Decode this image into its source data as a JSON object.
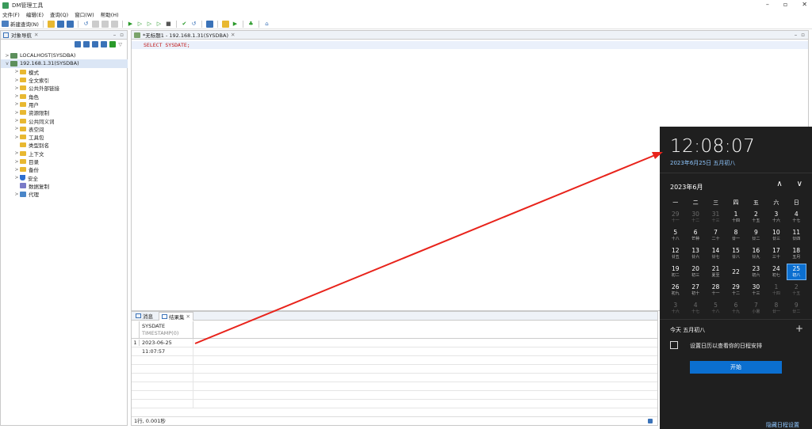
{
  "window": {
    "title": "DM管理工具",
    "min": "–",
    "max": "▫",
    "close": "✕"
  },
  "menu": [
    "文件(F)",
    "编辑(E)",
    "查询(Q)",
    "窗口(W)",
    "帮助(H)"
  ],
  "toolbar": {
    "new_query": "新建查询(N)"
  },
  "nav_panel": {
    "tab_label": "对象导航",
    "tree": [
      {
        "label": "LOCALHOST(SYSDBA)",
        "level": 0,
        "arrow": ">",
        "icon": "db"
      },
      {
        "label": "192.168.1.31(SYSDBA)",
        "level": 0,
        "arrow": "v",
        "icon": "db"
      },
      {
        "label": "模式",
        "level": 1,
        "arrow": ">",
        "icon": "folder"
      },
      {
        "label": "全文索引",
        "level": 1,
        "arrow": ">",
        "icon": "folder"
      },
      {
        "label": "公共外部链接",
        "level": 1,
        "arrow": ">",
        "icon": "folder"
      },
      {
        "label": "角色",
        "level": 1,
        "arrow": ">",
        "icon": "folder"
      },
      {
        "label": "用户",
        "level": 1,
        "arrow": ">",
        "icon": "folder"
      },
      {
        "label": "资源限制",
        "level": 1,
        "arrow": ">",
        "icon": "folder"
      },
      {
        "label": "公共同义词",
        "level": 1,
        "arrow": ">",
        "icon": "folder"
      },
      {
        "label": "表空间",
        "level": 1,
        "arrow": ">",
        "icon": "folder"
      },
      {
        "label": "工具包",
        "level": 1,
        "arrow": ">",
        "icon": "folder"
      },
      {
        "label": "类型别名",
        "level": 1,
        "arrow": "",
        "icon": "folder"
      },
      {
        "label": "上下文",
        "level": 1,
        "arrow": ">",
        "icon": "folder"
      },
      {
        "label": "目录",
        "level": 1,
        "arrow": ">",
        "icon": "folder"
      },
      {
        "label": "备份",
        "level": 1,
        "arrow": ">",
        "icon": "folder"
      },
      {
        "label": "安全",
        "level": 1,
        "arrow": ">",
        "icon": "shield"
      },
      {
        "label": "数据复制",
        "level": 1,
        "arrow": "",
        "icon": "repl"
      },
      {
        "label": "代理",
        "level": 1,
        "arrow": ">",
        "icon": "stack"
      }
    ]
  },
  "editor": {
    "tab_label": "*无标题1 - 192.168.1.31(SYSDBA)",
    "sql": "SELECT SYSDATE;"
  },
  "results": {
    "tabs": [
      "消息",
      "结果集"
    ],
    "column": {
      "name": "SYSDATE",
      "type": "TIMESTAMP(0)"
    },
    "rows": [
      {
        "num": "1",
        "value": "2023-06-25 11:07:57"
      }
    ],
    "status": "1行, 0.001秒"
  },
  "calendar": {
    "time": "12:08:07",
    "date": "2023年6月25日 五月初八",
    "month": "2023年6月",
    "weekdays": [
      "一",
      "二",
      "三",
      "四",
      "五",
      "六",
      "日"
    ],
    "days": [
      {
        "n": "29",
        "l": "十一",
        "dim": true
      },
      {
        "n": "30",
        "l": "十二",
        "dim": true
      },
      {
        "n": "31",
        "l": "十三",
        "dim": true
      },
      {
        "n": "1",
        "l": "十四"
      },
      {
        "n": "2",
        "l": "十五"
      },
      {
        "n": "3",
        "l": "十六"
      },
      {
        "n": "4",
        "l": "十七"
      },
      {
        "n": "5",
        "l": "十八"
      },
      {
        "n": "6",
        "l": "芒种"
      },
      {
        "n": "7",
        "l": "二十"
      },
      {
        "n": "8",
        "l": "廿一"
      },
      {
        "n": "9",
        "l": "廿二"
      },
      {
        "n": "10",
        "l": "廿三"
      },
      {
        "n": "11",
        "l": "廿四"
      },
      {
        "n": "12",
        "l": "廿五"
      },
      {
        "n": "13",
        "l": "廿六"
      },
      {
        "n": "14",
        "l": "廿七"
      },
      {
        "n": "15",
        "l": "廿八"
      },
      {
        "n": "16",
        "l": "廿九"
      },
      {
        "n": "17",
        "l": "三十"
      },
      {
        "n": "18",
        "l": "五月"
      },
      {
        "n": "19",
        "l": "初二"
      },
      {
        "n": "20",
        "l": "初三"
      },
      {
        "n": "21",
        "l": "夏至"
      },
      {
        "n": "22",
        "l": ""
      },
      {
        "n": "23",
        "l": "初六"
      },
      {
        "n": "24",
        "l": "初七"
      },
      {
        "n": "25",
        "l": "初八",
        "today": true
      },
      {
        "n": "26",
        "l": "初九"
      },
      {
        "n": "27",
        "l": "初十"
      },
      {
        "n": "28",
        "l": "十一"
      },
      {
        "n": "29",
        "l": "十二"
      },
      {
        "n": "30",
        "l": "十三"
      },
      {
        "n": "1",
        "l": "十四",
        "dim": true
      },
      {
        "n": "2",
        "l": "十五",
        "dim": true
      },
      {
        "n": "3",
        "l": "十六",
        "dim": true
      },
      {
        "n": "4",
        "l": "十七",
        "dim": true
      },
      {
        "n": "5",
        "l": "十八",
        "dim": true
      },
      {
        "n": "6",
        "l": "十九",
        "dim": true
      },
      {
        "n": "7",
        "l": "小暑",
        "dim": true
      },
      {
        "n": "8",
        "l": "廿一",
        "dim": true
      },
      {
        "n": "9",
        "l": "廿二",
        "dim": true
      }
    ],
    "agenda_title": "今天 五月初八",
    "no_events": "设置日历以查看你的日程安排",
    "start_button": "开始",
    "hide": "隐藏日程设置",
    "nav_up": "∧",
    "nav_down": "∨",
    "plus": "+"
  },
  "colors": {
    "annotation_arrow": "#e8231b",
    "accent": "#0b6fd0"
  }
}
